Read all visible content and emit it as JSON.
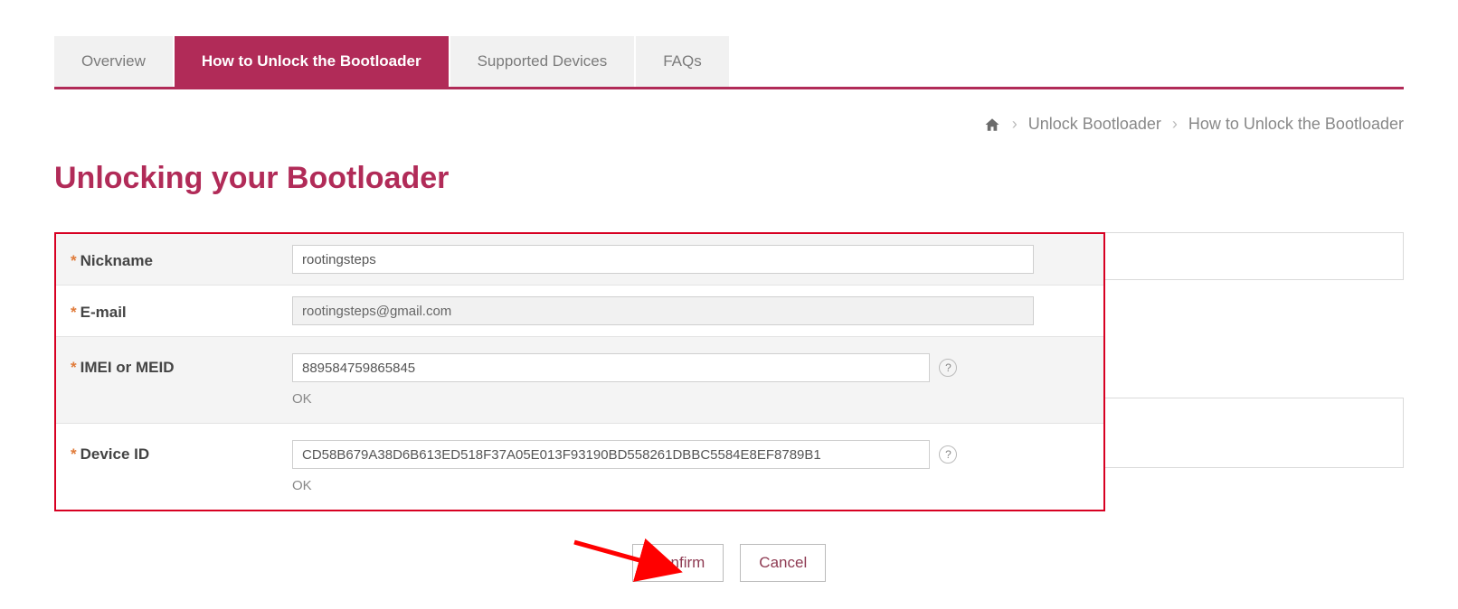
{
  "tabs": [
    {
      "label": "Overview",
      "active": false
    },
    {
      "label": "How to Unlock the Bootloader",
      "active": true
    },
    {
      "label": "Supported Devices",
      "active": false
    },
    {
      "label": "FAQs",
      "active": false
    }
  ],
  "breadcrumb": {
    "link": "Unlock Bootloader",
    "current": "How to Unlock the Bootloader"
  },
  "heading": "Unlocking your Bootloader",
  "form": {
    "nickname": {
      "label": "Nickname",
      "value": "rootingsteps"
    },
    "email": {
      "label": "E-mail",
      "value": "rootingsteps@gmail.com"
    },
    "imei": {
      "label": "IMEI or MEID",
      "value": "889584759865845",
      "status": "OK"
    },
    "deviceid": {
      "label": "Device ID",
      "value": "CD58B679A38D6B613ED518F37A05E013F93190BD558261DBBC5584E8EF8789B1",
      "status": "OK"
    }
  },
  "buttons": {
    "confirm": "Confirm",
    "cancel": "Cancel"
  },
  "help_glyph": "?"
}
